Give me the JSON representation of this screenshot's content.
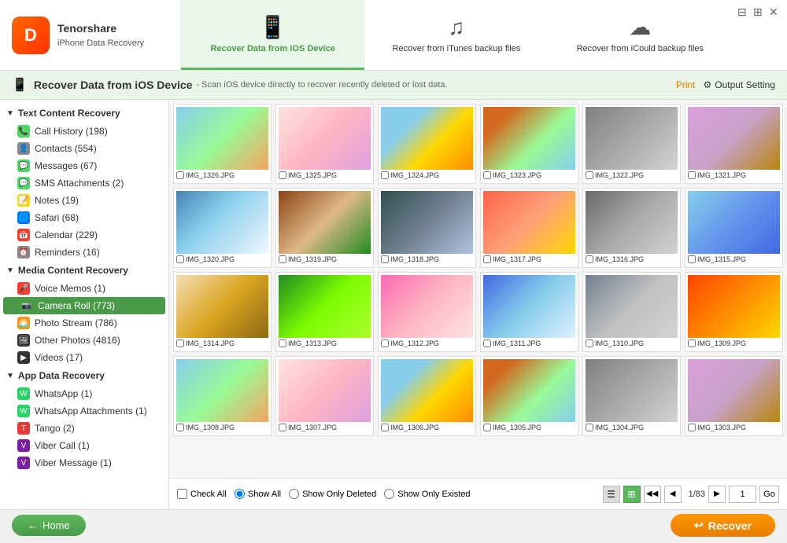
{
  "window": {
    "title": "Tenorshare iPhone Data Recovery"
  },
  "header": {
    "logo_letter": "D",
    "brand": "Tenorshare",
    "app_name": "iPhone Data Recovery",
    "tabs": [
      {
        "id": "ios",
        "icon": "📱",
        "label": "Recover Data from iOS Device",
        "active": true
      },
      {
        "id": "itunes",
        "icon": "♪",
        "label": "Recover from iTunes backup files",
        "active": false
      },
      {
        "id": "icloud",
        "icon": "☁",
        "label": "Recover from iCould backup files",
        "active": false
      }
    ]
  },
  "toolbar": {
    "title": "Recover Data from iOS Device",
    "description": "- Scan iOS device directly to recover recently deleted or lost data.",
    "print_label": "Print",
    "output_label": "Output Setting"
  },
  "sidebar": {
    "text_content_recovery": {
      "header": "Text Content Recovery",
      "items": [
        {
          "id": "call-history",
          "label": "Call History (198)",
          "icon": "📞",
          "icon_class": "icon-phone"
        },
        {
          "id": "contacts",
          "label": "Contacts (554)",
          "icon": "👤",
          "icon_class": "icon-contacts"
        },
        {
          "id": "messages",
          "label": "Messages (67)",
          "icon": "💬",
          "icon_class": "icon-messages"
        },
        {
          "id": "sms-attachments",
          "label": "SMS Attachments (2)",
          "icon": "💬",
          "icon_class": "icon-sms"
        },
        {
          "id": "notes",
          "label": "Notes (19)",
          "icon": "📝",
          "icon_class": "icon-notes"
        },
        {
          "id": "safari",
          "label": "Safari (68)",
          "icon": "🌐",
          "icon_class": "icon-safari"
        },
        {
          "id": "calendar",
          "label": "Calendar (229)",
          "icon": "📅",
          "icon_class": "icon-calendar"
        },
        {
          "id": "reminders",
          "label": "Reminders (16)",
          "icon": "⏰",
          "icon_class": "icon-reminders"
        }
      ]
    },
    "media_content_recovery": {
      "header": "Media Content Recovery",
      "items": [
        {
          "id": "voice-memos",
          "label": "Voice Memos (1)",
          "icon": "🎤",
          "icon_class": "icon-voice"
        },
        {
          "id": "camera-roll",
          "label": "Camera Roll (773)",
          "icon": "📷",
          "icon_class": "icon-camera",
          "active": true
        },
        {
          "id": "photo-stream",
          "label": "Photo Stream (786)",
          "icon": "🌅",
          "icon_class": "icon-photo"
        },
        {
          "id": "other-photos",
          "label": "Other Photos (4816)",
          "icon": "🖼",
          "icon_class": "icon-otherphotos"
        },
        {
          "id": "videos",
          "label": "Videos (17)",
          "icon": "▶",
          "icon_class": "icon-videos"
        }
      ]
    },
    "app_data_recovery": {
      "header": "App Data Recovery",
      "items": [
        {
          "id": "whatsapp",
          "label": "WhatsApp (1)",
          "icon": "W",
          "icon_class": "icon-whatsapp"
        },
        {
          "id": "whatsapp-attachments",
          "label": "WhatsApp Attachments (1)",
          "icon": "W",
          "icon_class": "icon-whatsapp-att"
        },
        {
          "id": "tango",
          "label": "Tango (2)",
          "icon": "T",
          "icon_class": "icon-tango"
        },
        {
          "id": "viber-call",
          "label": "Viber Call (1)",
          "icon": "V",
          "icon_class": "icon-viber-call"
        },
        {
          "id": "viber-message",
          "label": "Viber Message (1)",
          "icon": "V",
          "icon_class": "icon-viber-msg"
        }
      ]
    }
  },
  "photos": [
    {
      "id": 1,
      "name": "IMG_1326.JPG",
      "img_class": "img1"
    },
    {
      "id": 2,
      "name": "IMG_1325.JPG",
      "img_class": "img2"
    },
    {
      "id": 3,
      "name": "IMG_1324.JPG",
      "img_class": "img3"
    },
    {
      "id": 4,
      "name": "IMG_1323.JPG",
      "img_class": "img4"
    },
    {
      "id": 5,
      "name": "IMG_1322.JPG",
      "img_class": "img5"
    },
    {
      "id": 6,
      "name": "IMG_1321.JPG",
      "img_class": "img6"
    },
    {
      "id": 7,
      "name": "IMG_1320.JPG",
      "img_class": "img7"
    },
    {
      "id": 8,
      "name": "IMG_1319.JPG",
      "img_class": "img8"
    },
    {
      "id": 9,
      "name": "IMG_1318.JPG",
      "img_class": "img9"
    },
    {
      "id": 10,
      "name": "IMG_1317.JPG",
      "img_class": "img10"
    },
    {
      "id": 11,
      "name": "IMG_1316.JPG",
      "img_class": "img11"
    },
    {
      "id": 12,
      "name": "IMG_1315.JPG",
      "img_class": "img12"
    },
    {
      "id": 13,
      "name": "IMG_1314.JPG",
      "img_class": "img13"
    },
    {
      "id": 14,
      "name": "IMG_1313.JPG",
      "img_class": "img14"
    },
    {
      "id": 15,
      "name": "IMG_1312.JPG",
      "img_class": "img15"
    },
    {
      "id": 16,
      "name": "IMG_1311.JPG",
      "img_class": "img16"
    },
    {
      "id": 17,
      "name": "IMG_1310.JPG",
      "img_class": "img17"
    },
    {
      "id": 18,
      "name": "IMG_1309.JPG",
      "img_class": "img18"
    },
    {
      "id": 19,
      "name": "IMG_1308.JPG",
      "img_class": "img1"
    },
    {
      "id": 20,
      "name": "IMG_1307.JPG",
      "img_class": "img2"
    },
    {
      "id": 21,
      "name": "IMG_1306.JPG",
      "img_class": "img3"
    },
    {
      "id": 22,
      "name": "IMG_1305.JPG",
      "img_class": "img4"
    },
    {
      "id": 23,
      "name": "IMG_1304.JPG",
      "img_class": "img5"
    },
    {
      "id": 24,
      "name": "IMG_1303.JPG",
      "img_class": "img6"
    }
  ],
  "bottom_bar": {
    "check_all": "Check All",
    "show_all": "Show All",
    "show_only_deleted": "Show Only Deleted",
    "show_only_existed": "Show Only Existed",
    "page_info": "1/83",
    "page_number": "1"
  },
  "footer": {
    "home_label": "Home",
    "recover_label": "Recover"
  }
}
